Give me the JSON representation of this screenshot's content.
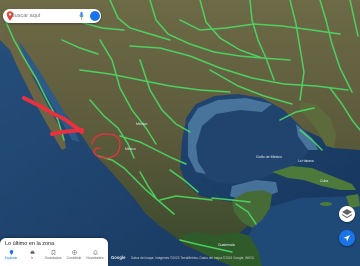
{
  "search": {
    "placeholder": "Buscar aquí"
  },
  "explore": {
    "title": "Lo último en la zona",
    "nav": [
      "Explorar",
      "Ir",
      "Guardados",
      "Contribuir",
      "Novedades"
    ]
  },
  "map_labels": {
    "mexico": "México",
    "gulf": "Golfo de México",
    "guatemala": "Guatemala",
    "mexico_city": "México",
    "havana": "La Habana",
    "cuba": "Cuba"
  },
  "brand": "Google",
  "attribution": "Datos del mapa: Imágenes ©2023 TerraMetrics, Datos del mapa ©2023 Google, INEGI",
  "colors": {
    "land": "#5e5c3c",
    "ocean": "#1b3f6b",
    "shelf": "#5682a8",
    "roads": "#4cd964",
    "annotation": "#e8313e",
    "accent": "#1a73e8"
  },
  "icons": {
    "search": "pin-icon",
    "mic": "mic-icon",
    "layers": "layers-icon",
    "location": "my-location-icon"
  }
}
